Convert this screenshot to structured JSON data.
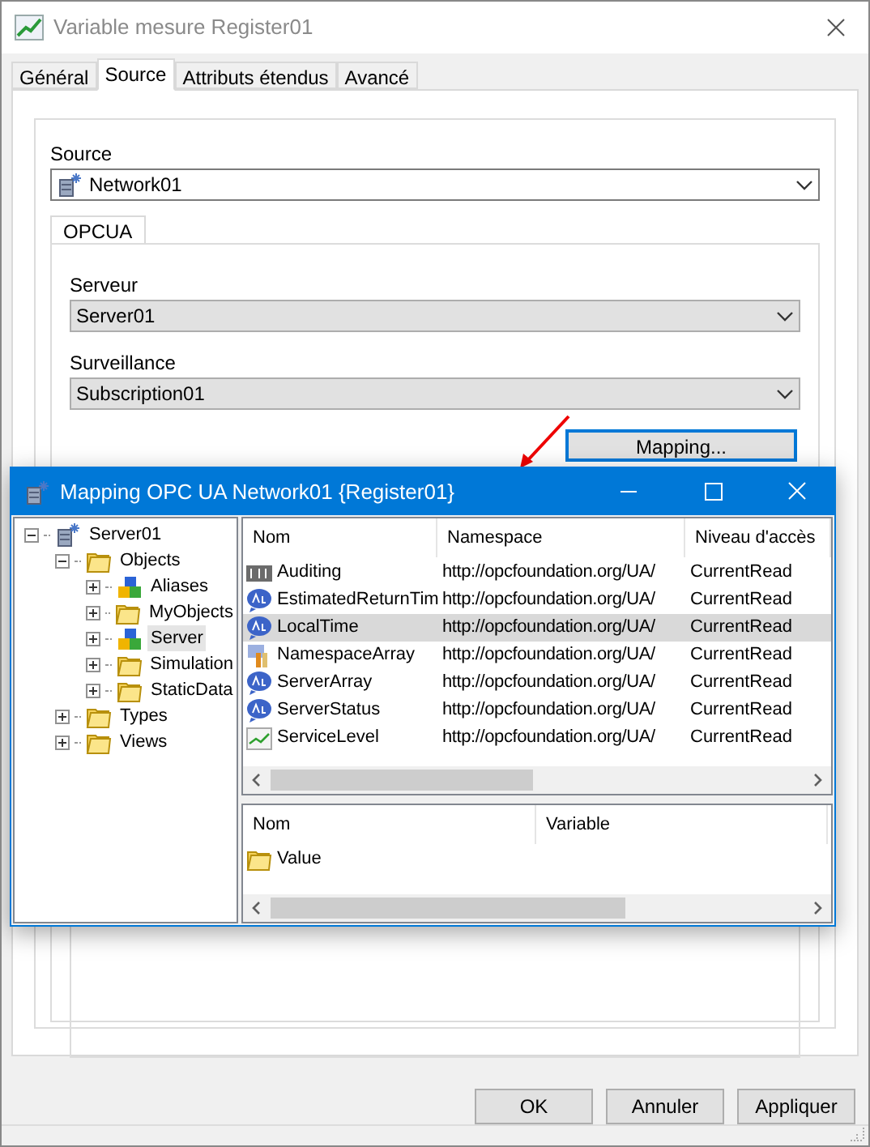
{
  "window": {
    "title": "Variable mesure Register01"
  },
  "tabs": [
    {
      "label": "Général",
      "selected": false
    },
    {
      "label": "Source",
      "selected": true
    },
    {
      "label": "Attributs étendus",
      "selected": false
    },
    {
      "label": "Avancé",
      "selected": false
    }
  ],
  "source": {
    "label": "Source",
    "value": "Network01"
  },
  "protocol_tab": {
    "label": "OPCUA",
    "selected": true
  },
  "server": {
    "label": "Serveur",
    "value": "Server01"
  },
  "subscription": {
    "label": "Surveillance",
    "value": "Subscription01"
  },
  "mapping_button": {
    "label": "Mapping...",
    "focused": true
  },
  "footer_buttons": [
    "OK",
    "Annuler",
    "Appliquer"
  ],
  "mapping_dialog": {
    "title": "Mapping OPC UA Network01 {Register01}",
    "tree": [
      {
        "label": "Server01",
        "kind": "server",
        "expanded": true,
        "selected": false,
        "children": [
          {
            "label": "Objects",
            "kind": "folder",
            "expanded": true,
            "selected": false,
            "children": [
              {
                "label": "Aliases",
                "kind": "object",
                "expanded": false,
                "selected": false
              },
              {
                "label": "MyObjects",
                "kind": "folder",
                "expanded": false,
                "selected": false
              },
              {
                "label": "Server",
                "kind": "object",
                "expanded": false,
                "selected": true
              },
              {
                "label": "Simulation",
                "kind": "folder",
                "expanded": false,
                "selected": false
              },
              {
                "label": "StaticData",
                "kind": "folder",
                "expanded": false,
                "selected": false
              }
            ]
          },
          {
            "label": "Types",
            "kind": "folder",
            "expanded": false,
            "selected": false
          },
          {
            "label": "Views",
            "kind": "folder",
            "expanded": false,
            "selected": false
          }
        ]
      }
    ],
    "nodes": {
      "columns": [
        "Nom",
        "Namespace",
        "Niveau d'accès"
      ],
      "rows": [
        {
          "kind": "boolean",
          "name": "Auditing",
          "namespace": "http://opcfoundation.org/UA/",
          "access": "CurrentRead",
          "selected": false
        },
        {
          "kind": "text",
          "name": "EstimatedReturnTim",
          "namespace": "http://opcfoundation.org/UA/",
          "access": "CurrentRead",
          "selected": false
        },
        {
          "kind": "text",
          "name": "LocalTime",
          "namespace": "http://opcfoundation.org/UA/",
          "access": "CurrentRead",
          "selected": true
        },
        {
          "kind": "array",
          "name": "NamespaceArray",
          "namespace": "http://opcfoundation.org/UA/",
          "access": "CurrentRead",
          "selected": false
        },
        {
          "kind": "text",
          "name": "ServerArray",
          "namespace": "http://opcfoundation.org/UA/",
          "access": "CurrentRead",
          "selected": false
        },
        {
          "kind": "text",
          "name": "ServerStatus",
          "namespace": "http://opcfoundation.org/UA/",
          "access": "CurrentRead",
          "selected": false
        },
        {
          "kind": "trend",
          "name": "ServiceLevel",
          "namespace": "http://opcfoundation.org/UA/",
          "access": "CurrentRead",
          "selected": false
        }
      ]
    },
    "mappings": {
      "columns": [
        "Nom",
        "Variable"
      ],
      "rows": [
        {
          "name": "Value"
        }
      ]
    }
  }
}
